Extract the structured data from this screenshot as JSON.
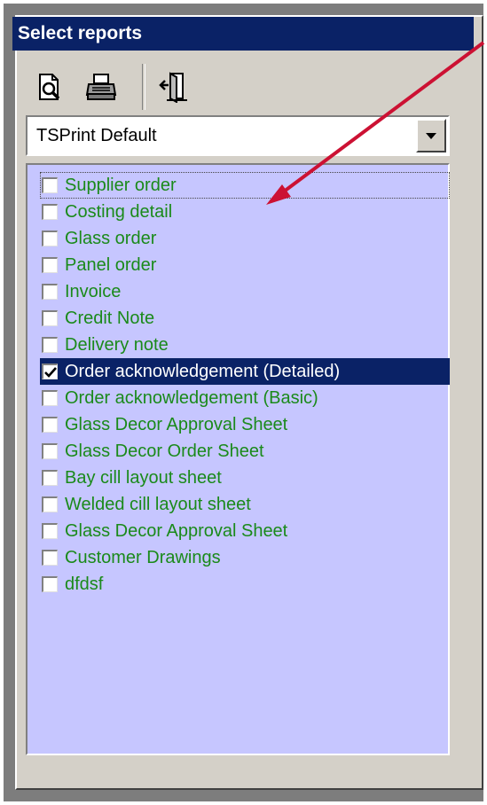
{
  "panel": {
    "title": "Select reports"
  },
  "toolbar": {
    "buttons": [
      {
        "name": "print-preview-icon"
      },
      {
        "name": "printer-icon"
      },
      {
        "name": "exit-icon"
      }
    ]
  },
  "printer_select": {
    "value": "TSPrint Default"
  },
  "reports": [
    {
      "label": "Supplier order",
      "checked": false
    },
    {
      "label": "Costing detail",
      "checked": false
    },
    {
      "label": "Glass order",
      "checked": false
    },
    {
      "label": "Panel order",
      "checked": false
    },
    {
      "label": "Invoice",
      "checked": false
    },
    {
      "label": "Credit Note",
      "checked": false
    },
    {
      "label": "Delivery note",
      "checked": false
    },
    {
      "label": "Order acknowledgement (Detailed)",
      "checked": true,
      "selected": true
    },
    {
      "label": "Order acknowledgement (Basic)",
      "checked": false
    },
    {
      "label": "Glass Decor Approval Sheet",
      "checked": false
    },
    {
      "label": "Glass Decor Order Sheet",
      "checked": false
    },
    {
      "label": "Bay cill layout sheet",
      "checked": false
    },
    {
      "label": "Welded cill layout sheet",
      "checked": false
    },
    {
      "label": "Glass Decor Approval Sheet",
      "checked": false
    },
    {
      "label": "Customer Drawings",
      "checked": false
    },
    {
      "label": "dfdsf",
      "checked": false
    }
  ],
  "colors": {
    "title_bg": "#0a2266",
    "list_bg": "#c6c6ff",
    "item_text": "#1a8a1a",
    "annotation_arrow": "#cc1133"
  }
}
